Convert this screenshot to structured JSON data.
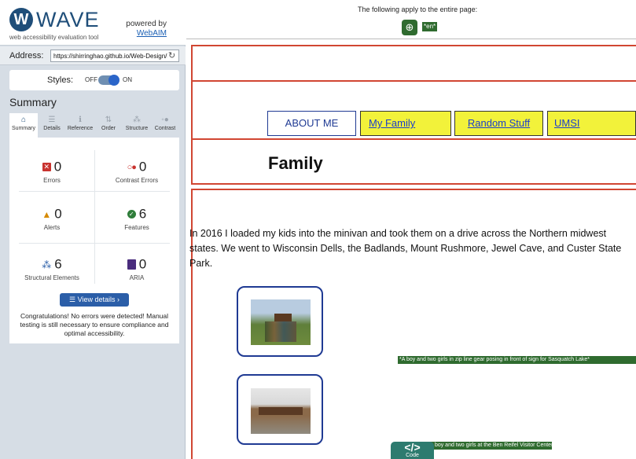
{
  "wave": {
    "logo_letter": "W",
    "wordmark": "WAVE",
    "tagline": "web accessibility evaluation tool",
    "powered_by": "powered by",
    "webaim_link": "WebAIM"
  },
  "address": {
    "label": "Address:",
    "value": "https://shirringhao.github.io/Web-Design/hw",
    "reload_icon": "↻"
  },
  "styles": {
    "label": "Styles:",
    "off_label": "OFF",
    "on_label": "ON",
    "state": "on"
  },
  "summary": {
    "heading": "Summary",
    "tabs": [
      {
        "icon": "⌂",
        "label": "Summary",
        "icon_name": "home-icon",
        "active": true
      },
      {
        "icon": "☰",
        "label": "Details",
        "icon_name": "list-icon",
        "active": false
      },
      {
        "icon": "ℹ",
        "label": "Reference",
        "icon_name": "info-icon",
        "active": false
      },
      {
        "icon": "⇅",
        "label": "Order",
        "icon_name": "order-icon",
        "active": false
      },
      {
        "icon": "⁂",
        "label": "Structure",
        "icon_name": "structure-icon",
        "active": false
      },
      {
        "icon": "◦●",
        "label": "Contrast",
        "icon_name": "contrast-icon",
        "active": false
      }
    ],
    "stats": {
      "errors": {
        "value": "0",
        "label": "Errors",
        "icon": "✕"
      },
      "contrast_errors": {
        "value": "0",
        "label": "Contrast Errors",
        "icon": "○●"
      },
      "alerts": {
        "value": "0",
        "label": "Alerts",
        "icon": "▲"
      },
      "features": {
        "value": "6",
        "label": "Features",
        "icon": "✓"
      },
      "structural": {
        "value": "6",
        "label": "Structural Elements",
        "icon": "⁂"
      },
      "aria": {
        "value": "0",
        "label": "ARIA",
        "icon": ""
      }
    },
    "view_details": "☰  View details ›",
    "congrats": "Congratulations! No errors were detected! Manual testing is still necessary to ensure compliance and optimal accessibility."
  },
  "page": {
    "applies_text": "The following apply to the entire page:",
    "globe_icon": "⊕",
    "lang_badge": "*en*",
    "nav": {
      "about": "ABOUT ME",
      "family": "My Family",
      "random": "Random Stuff",
      "umsi": "UMSI"
    },
    "heading": "Family",
    "intro": "In 2016 I loaded my kids into the minivan and took them on a drive across the Northern midwest states. We went to Wisconsin Dells, the Badlands, Mount Rushmore, Jewel Cave, and Custer State Park.",
    "alt_1": "*A boy and two girls in zip line gear posing in front of sign for Sasquatch Lake*",
    "alt_2": "*A boy and two girls at the Ben Reifel Visitor Center*",
    "code_tab_icon": "</>",
    "code_tab_label": "Code"
  },
  "colors": {
    "wave_brand": "#1f4e79",
    "error_red": "#c8332f",
    "feature_green": "#2f7d3a",
    "alt_badge_green": "#2f6b2f",
    "nav_yellow": "#f2f23a",
    "border_red": "#d14632"
  }
}
